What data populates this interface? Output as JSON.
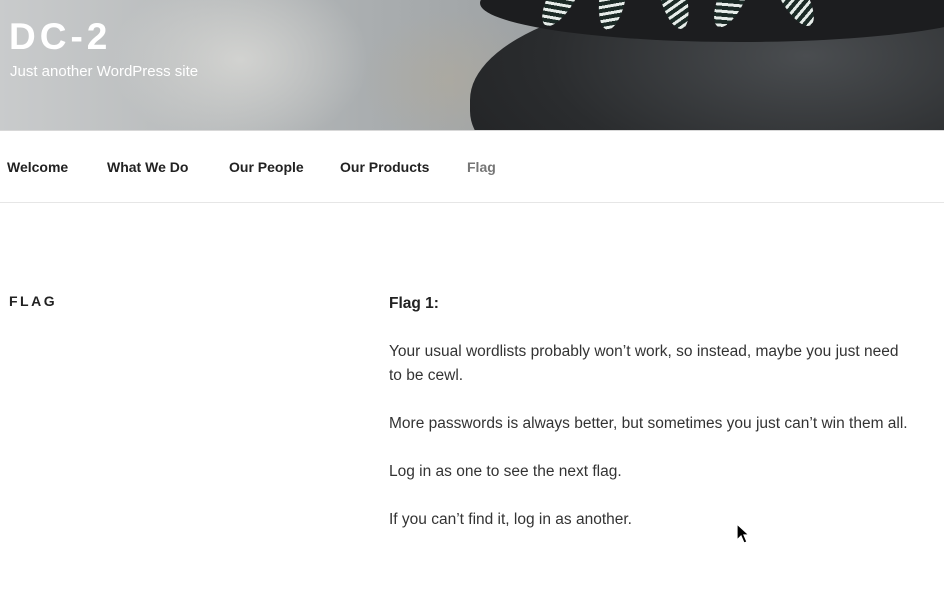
{
  "header": {
    "site_title": "DC-2",
    "site_description": "Just another WordPress site"
  },
  "nav": {
    "items": [
      {
        "label": "Welcome"
      },
      {
        "label": "What We Do"
      },
      {
        "label": "Our People"
      },
      {
        "label": "Our Products"
      },
      {
        "label": "Flag",
        "current": true
      }
    ]
  },
  "page": {
    "title": "FLAG",
    "heading": "Flag 1:",
    "paragraphs": [
      "Your usual wordlists probably won’t work, so instead, maybe you just need to be cewl.",
      "More passwords is always better, but sometimes you just can’t win them all.",
      "Log in as one to see the next flag.",
      "If you can’t find it, log in as another."
    ]
  },
  "colors": {
    "nav_current": "#767676",
    "text": "#333333"
  }
}
